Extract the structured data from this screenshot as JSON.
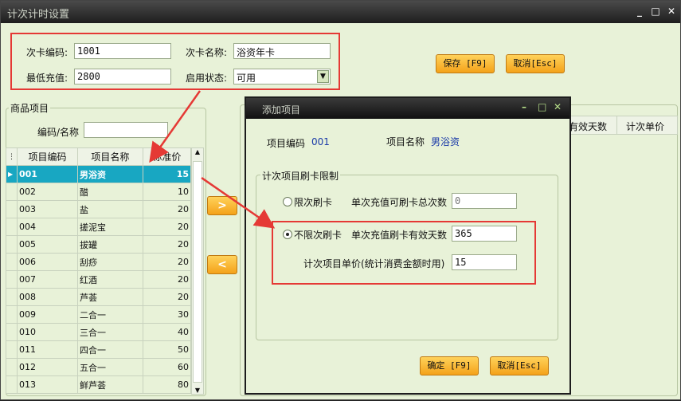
{
  "window": {
    "title": "计次计时设置",
    "min": "_",
    "max": "□",
    "close": "✕"
  },
  "form": {
    "card_code_label": "次卡编码:",
    "card_code": "1001",
    "card_name_label": "次卡名称:",
    "card_name": "浴资年卡",
    "min_recharge_label": "最低充值:",
    "min_recharge": "2800",
    "status_label": "启用状态:",
    "status": "可用"
  },
  "toolbar": {
    "save": "保存 [F9]",
    "cancel": "取消[Esc]"
  },
  "left": {
    "group_title": "商品项目",
    "filter_label": "编码/名称",
    "columns": [
      "项目编码",
      "项目名称",
      "标准价"
    ],
    "rows": [
      {
        "code": "001",
        "name": "男浴资",
        "price": "15"
      },
      {
        "code": "002",
        "name": "醋",
        "price": "10"
      },
      {
        "code": "003",
        "name": "盐",
        "price": "20"
      },
      {
        "code": "004",
        "name": "搓泥宝",
        "price": "20"
      },
      {
        "code": "005",
        "name": "拔罐",
        "price": "20"
      },
      {
        "code": "006",
        "name": "刮痧",
        "price": "20"
      },
      {
        "code": "007",
        "name": "红酒",
        "price": "20"
      },
      {
        "code": "008",
        "name": "芦荟",
        "price": "20"
      },
      {
        "code": "009",
        "name": "二合一",
        "price": "30"
      },
      {
        "code": "010",
        "name": "三合一",
        "price": "40"
      },
      {
        "code": "011",
        "name": "四合一",
        "price": "50"
      },
      {
        "code": "012",
        "name": "五合一",
        "price": "60"
      },
      {
        "code": "013",
        "name": "鲜芦荟",
        "price": "80"
      }
    ]
  },
  "transfer": {
    "add": ">",
    "remove": "<"
  },
  "right": {
    "columns": [
      "有效天数",
      "计次单价"
    ]
  },
  "dialog": {
    "title": "添加项目",
    "item_code_label": "项目编码",
    "item_code": "001",
    "item_name_label": "项目名称",
    "item_name": "男浴资",
    "group_title": "计次项目刷卡限制",
    "limited_label": "限次刷卡",
    "limited_count_label": "单次充值可刷卡总次数",
    "limited_count": "0",
    "unlimited_label": "不限次刷卡",
    "valid_days_label": "单次充值刷卡有效天数",
    "valid_days": "365",
    "unit_price_label": "计次项目单价(统计消费金额时用)",
    "unit_price": "15",
    "ok": "确定 [F9]",
    "cancel": "取消[Esc]"
  },
  "colors": {
    "accent": "#f4a21a",
    "highlight": "#e53935",
    "selected_row": "#18a7c2"
  }
}
